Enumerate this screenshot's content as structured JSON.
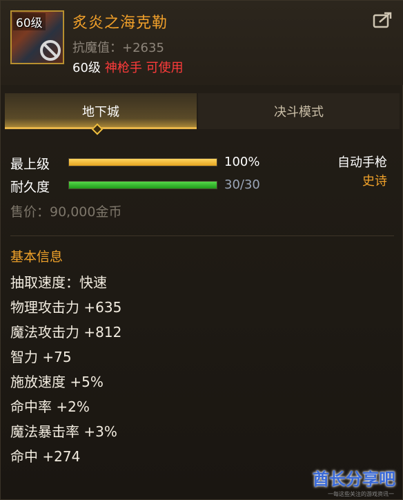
{
  "item": {
    "level_tag": "60级",
    "name": "炙炎之海克勒",
    "stat": "抗魔值：+2635",
    "req_level": "60级",
    "req_class": "神枪手 可使用"
  },
  "tabs": [
    {
      "label": "地下城",
      "active": true
    },
    {
      "label": "决斗模式",
      "active": false
    }
  ],
  "upgrade": {
    "label": "最上级",
    "value_text": "100%",
    "fraction": 1.0
  },
  "durability": {
    "label": "耐久度",
    "value_text": "30/30",
    "fraction": 1.0
  },
  "weapon_type": "自动手枪",
  "rarity": "史诗",
  "price": "售价：90,000金币",
  "basic_info": {
    "title": "基本信息",
    "attrs": [
      "抽取速度：快速",
      "物理攻击力 +635",
      "魔法攻击力 +812",
      "智力 +75",
      "施放速度 +5%",
      "命中率 +2%",
      "魔法暴击率 +3%",
      "命中 +274"
    ]
  },
  "watermark": {
    "main": "酋长分享吧",
    "sub": "一每这些关注的游戏资讯一"
  },
  "colors": {
    "item_name": "#f1a02a",
    "class_req": "#ff3b3b",
    "rarity": "#f0a22a",
    "upgrade_bar": "#e4a420",
    "durability_bar": "#1f9a1a"
  },
  "icons": {
    "share": "share-export-icon",
    "forbid": "forbidden-icon"
  }
}
